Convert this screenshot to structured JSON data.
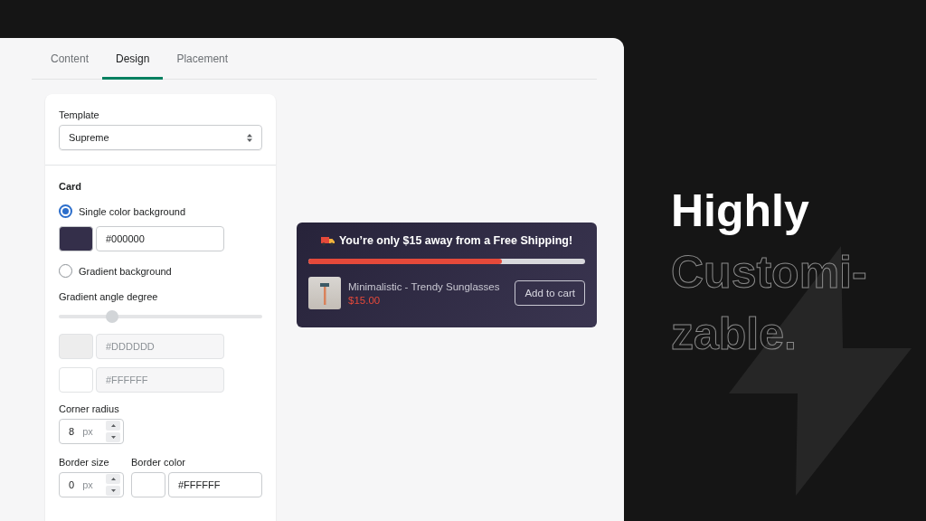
{
  "tabs": [
    {
      "label": "Content",
      "selected": false
    },
    {
      "label": "Design",
      "selected": true
    },
    {
      "label": "Placement",
      "selected": false
    }
  ],
  "template": {
    "label": "Template",
    "value": "Supreme"
  },
  "card": {
    "title": "Card",
    "single": {
      "label": "Single color background",
      "selected": true,
      "color": "#342f4a",
      "value": "#000000"
    },
    "gradient": {
      "label": "Gradient background",
      "selected": false,
      "angle_label": "Gradient angle degree",
      "level": 0.26,
      "stops": [
        {
          "color": "#ededed",
          "value": "#DDDDDD",
          "disabled": true
        },
        {
          "color": "#ffffff",
          "value": "#FFFFFF",
          "disabled": true
        }
      ]
    },
    "corner_radius": {
      "label": "Corner radius",
      "value": "8",
      "unit": "px"
    },
    "border_size": {
      "label": "Border size",
      "value": "0",
      "unit": "px"
    },
    "border_color": {
      "label": "Border color",
      "color": "#ffffff",
      "value": "#FFFFFF",
      "disabled": false
    }
  },
  "preview": {
    "message": "You’re only $15 away from a Free Shipping!",
    "level": 0.7,
    "product": "Minimalistic - Trendy Sunglasses",
    "price": "$15.00",
    "button": "Add to cart"
  },
  "headline": [
    {
      "text": "Highly",
      "kind": "solid"
    },
    {
      "text": "Customi-",
      "kind": "outline"
    },
    {
      "text": "zable.",
      "kind": "outline"
    }
  ]
}
